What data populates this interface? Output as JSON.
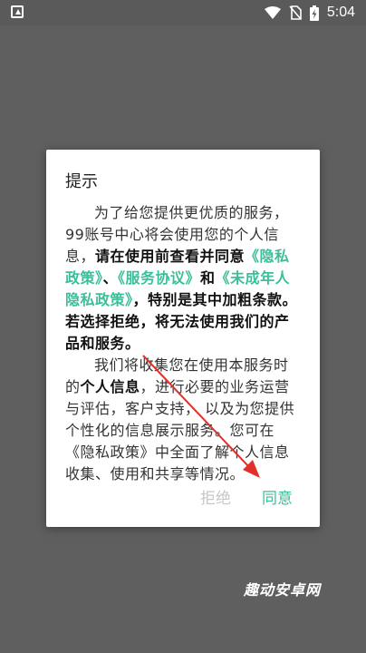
{
  "status_bar": {
    "time": "5:04"
  },
  "dialog": {
    "title": "提示",
    "para1": {
      "intro": "为了给您提供更优质的服务，99账号中心将会使用您的个人信息，",
      "bold_a": "请在使用前查看并同意",
      "link_privacy": "《隐私政策》",
      "sep1": "、",
      "link_service": "《服务协议》",
      "sep2": "和",
      "link_minor": "《未成年人隐私政策》",
      "bold_b": "，特别是其中加粗条款。若选择拒绝，将无法使用我们的产品和服务。"
    },
    "para2": {
      "text_a": "我们将收集您在使用本服务时的",
      "bold": "个人信息",
      "text_b": "，进行必要的业务运营与评估，客户支持， 以及为您提供个性化的信息展示服务。您可在",
      "link_privacy": "《隐私政策》",
      "text_c": "中全面了解个人信息收集、使用和共享等情况。"
    },
    "reject_label": "拒绝",
    "agree_label": "同意"
  },
  "watermark": "趣动安卓网",
  "colors": {
    "accent": "#3bbf9a",
    "scrim": "#5f5f5f",
    "disabled": "#c7c7c7"
  }
}
